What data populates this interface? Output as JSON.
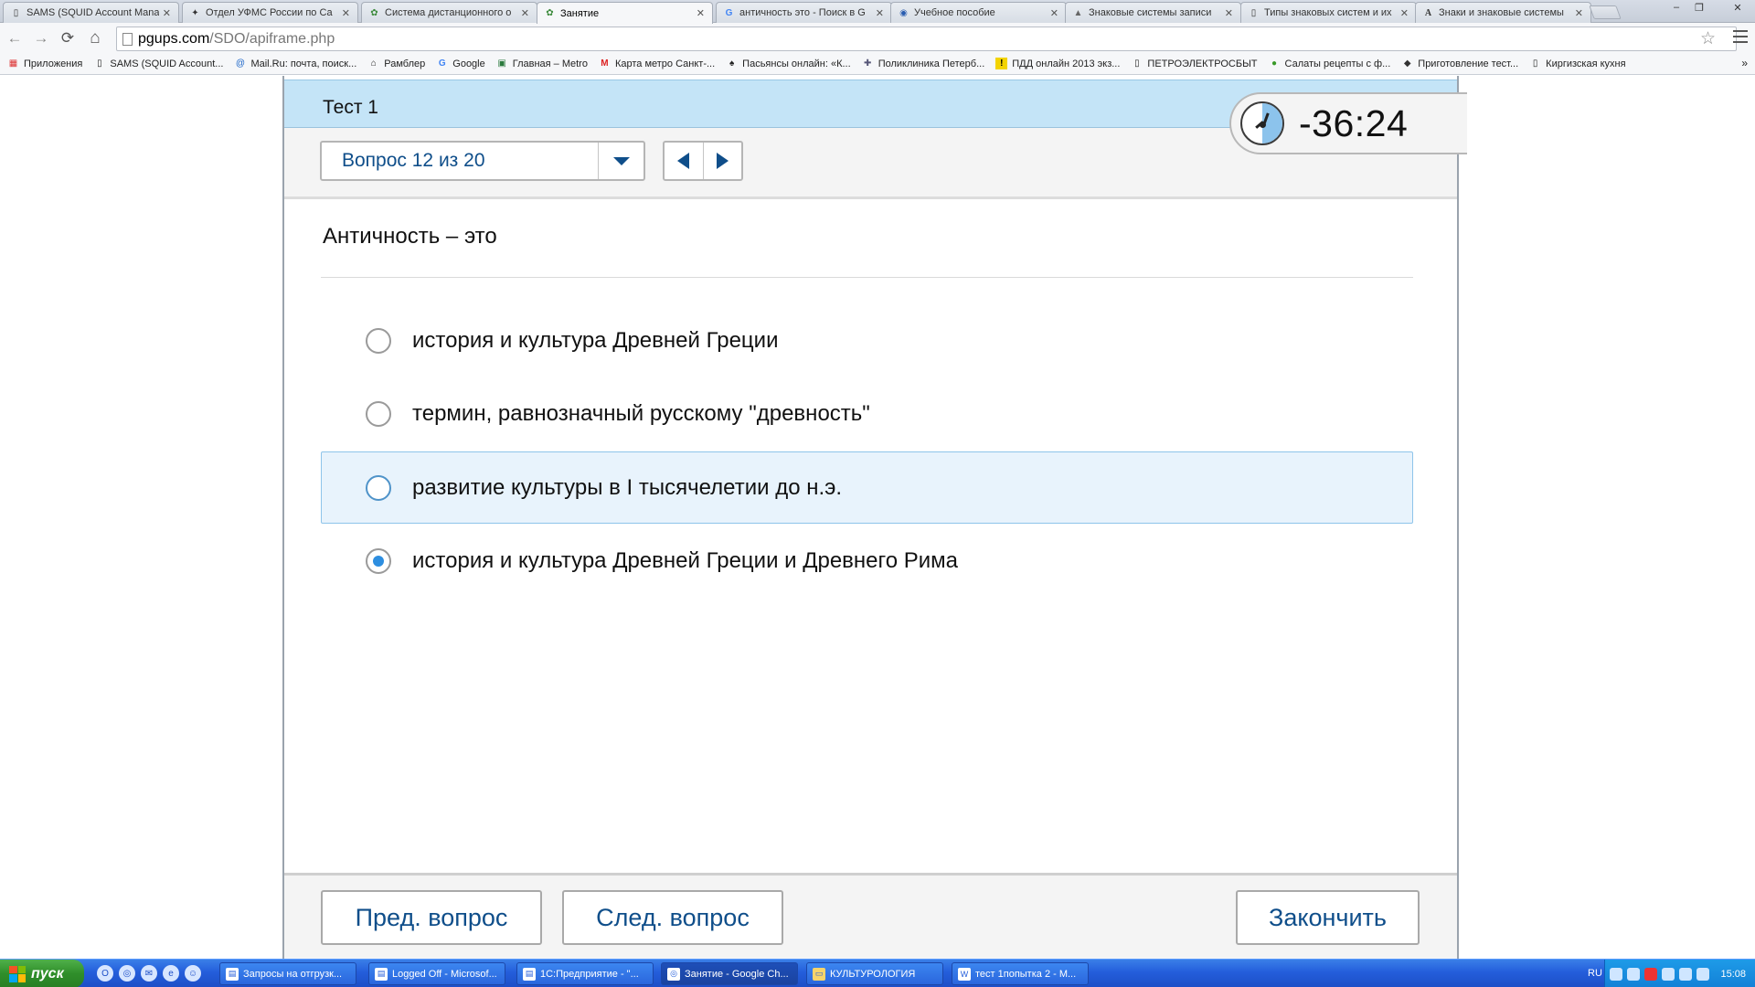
{
  "browser": {
    "tabs": [
      {
        "title": "SAMS (SQUID Account Mana",
        "icon": "document-icon",
        "active": false
      },
      {
        "title": "Отдел УФМС России по Са",
        "icon": "emblem-icon",
        "active": false
      },
      {
        "title": "Система дистанционного о",
        "icon": "gear-green-icon",
        "active": false
      },
      {
        "title": "Занятие",
        "icon": "gear-green-icon",
        "active": true
      },
      {
        "title": "античность это - Поиск в G",
        "icon": "google-icon",
        "active": false
      },
      {
        "title": "Учебное пособие",
        "icon": "globe-icon",
        "active": false
      },
      {
        "title": "Знаковые системы записи",
        "icon": "chart-icon",
        "active": false
      },
      {
        "title": "Типы знаковых систем и их",
        "icon": "document-icon",
        "active": false
      },
      {
        "title": "Знаки и знаковые системы",
        "icon": "letter-a-icon",
        "active": false
      }
    ],
    "close_glyph": "✕",
    "window_controls": {
      "minimize": "–",
      "maximize": "❐",
      "close": "✕"
    },
    "url_host": "pgups.com",
    "url_path": "/SDO/apiframe.php",
    "nav_icons": {
      "back": "←",
      "forward": "→",
      "reload": "⟳",
      "home": "⌂"
    },
    "star_glyph": "☆",
    "bookmarks": [
      {
        "label": "Приложения",
        "icon": "apps-grid-icon"
      },
      {
        "label": "SAMS (SQUID Account...",
        "icon": "document-icon"
      },
      {
        "label": "Mail.Ru: почта, поиск...",
        "icon": "mailru-icon"
      },
      {
        "label": "Рамблер",
        "icon": "home-icon"
      },
      {
        "label": "Google",
        "icon": "google-icon"
      },
      {
        "label": "Главная – Metro",
        "icon": "metro-icon"
      },
      {
        "label": "Карта метро Санкт-...",
        "icon": "metro-m-icon"
      },
      {
        "label": "Пасьянсы онлайн: «К...",
        "icon": "spade-icon"
      },
      {
        "label": "Поликлиника Петерб...",
        "icon": "clinic-icon"
      },
      {
        "label": "ПДД онлайн 2013 экз...",
        "icon": "warning-icon"
      },
      {
        "label": "ПЕТРОЭЛЕКТРОСБЫТ",
        "icon": "document-icon"
      },
      {
        "label": "Салаты рецепты с ф...",
        "icon": "leaf-icon"
      },
      {
        "label": "Приготовление тест...",
        "icon": "dough-icon"
      },
      {
        "label": "Киргизская кухня",
        "icon": "document-icon"
      }
    ],
    "bookmarks_more": "»"
  },
  "quiz": {
    "test_title": "Тест 1",
    "question_selector": "Вопрос 12 из 20",
    "timer": "-36:24",
    "question": "Античность – это",
    "options": [
      {
        "label": "история и культура Древней Греции",
        "selected": false,
        "highlight": false
      },
      {
        "label": "термин, равнозначный русскому \"древность\"",
        "selected": false,
        "highlight": false
      },
      {
        "label": "развитие культуры в I тысячелетии до н.э.",
        "selected": false,
        "highlight": true
      },
      {
        "label": "история и культура Древней Греции и Древнего Рима",
        "selected": true,
        "highlight": false
      }
    ],
    "buttons": {
      "prev": "Пред. вопрос",
      "next": "След. вопрос",
      "finish": "Закончить"
    },
    "colors": {
      "accent": "#0f4e8a",
      "header": "#c4e4f7",
      "radio_selected": "#2d8ee0",
      "highlight": "#e8f3fc"
    }
  },
  "taskbar": {
    "start_label": "пуск",
    "tasks": [
      {
        "label": "Запросы на отгрузк...",
        "active": false
      },
      {
        "label": "Logged Off - Microsof...",
        "active": false
      },
      {
        "label": "1С:Предприятие - \"...",
        "active": false
      },
      {
        "label": "Занятие - Google Ch...",
        "active": true
      },
      {
        "label": "КУЛЬТУРОЛОГИЯ",
        "active": false
      },
      {
        "label": "тест 1попытка 2 - M...",
        "active": false
      }
    ],
    "lang": "RU",
    "time": "15:08"
  }
}
